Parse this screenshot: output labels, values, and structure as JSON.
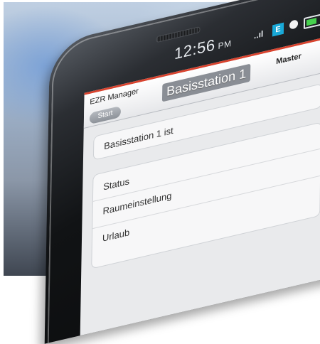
{
  "status": {
    "time": "12:56",
    "ampm": "PM",
    "signal": "..ıl",
    "network": "E"
  },
  "app": {
    "name": "EZR Manager",
    "title": "Basisstation 1",
    "master": "Master",
    "back": "Start"
  },
  "cards": {
    "primary": "Basisstation 1 ist",
    "menu": [
      "Status",
      "Raumeinstellung",
      "Urlaub"
    ]
  },
  "colors": {
    "accent": "#d9432e",
    "battery": "#47d14e",
    "network": "#19a9d8"
  }
}
